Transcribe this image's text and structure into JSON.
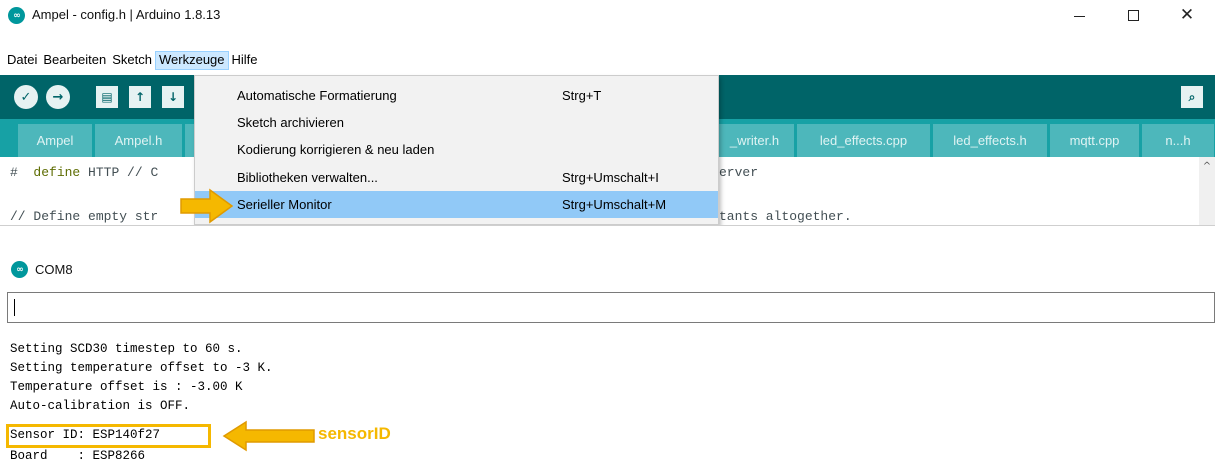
{
  "window": {
    "title": "Ampel - config.h | Arduino 1.8.13",
    "logo_glyph": "∞",
    "minimize_glyph": "—",
    "close_glyph": "✕"
  },
  "menubar": {
    "items": [
      {
        "label": "Datei"
      },
      {
        "label": "Bearbeiten"
      },
      {
        "label": "Sketch"
      },
      {
        "label": "Werkzeuge",
        "active": true
      },
      {
        "label": "Hilfe"
      }
    ]
  },
  "toolbar": {
    "verify_icon": "✓",
    "upload_icon": "→",
    "new_icon": "▤",
    "open_icon": "↑",
    "save_icon": "↓",
    "serial_monitor_icon": "⌕",
    "accent": "#006468"
  },
  "tabs": [
    {
      "label": "Ampel"
    },
    {
      "label": "Ampel.h"
    },
    {
      "label": "_writer.h"
    },
    {
      "label": "led_effects.cpp"
    },
    {
      "label": "led_effects.h"
    },
    {
      "label": "mqtt.cpp"
    },
    {
      "label": "n...h"
    }
  ],
  "editor": {
    "line1_hash": "#",
    "line1_keyword": "define",
    "line1_rest": "HTTP // C",
    "line1_tail": "erver",
    "line2": "// Define empty str",
    "line2_tail": "tants altogether.",
    "scroll_up_glyph": "^"
  },
  "tools_menu": {
    "items": [
      {
        "label": "Automatische Formatierung",
        "shortcut": "Strg+T"
      },
      {
        "label": "Sketch archivieren",
        "shortcut": ""
      },
      {
        "label": "Kodierung korrigieren & neu laden",
        "shortcut": ""
      },
      {
        "label": "Bibliotheken verwalten...",
        "shortcut": "Strg+Umschalt+I"
      },
      {
        "label": "Serieller Monitor",
        "shortcut": "Strg+Umschalt+M",
        "highlighted": true
      }
    ],
    "highlight_color": "#91c9f7"
  },
  "serial_monitor": {
    "title": "COM8",
    "input_value": "",
    "output_lines": [
      "Setting SCD30 timestep to 60 s.",
      "Setting temperature offset to -3 K.",
      "Temperature offset is : -3.00 K",
      "Auto-calibration is OFF.",
      "Sensor ID: ESP140f27",
      "Board    : ESP8266"
    ]
  },
  "annotations": {
    "label": "sensorID",
    "color": "#f5b800"
  }
}
